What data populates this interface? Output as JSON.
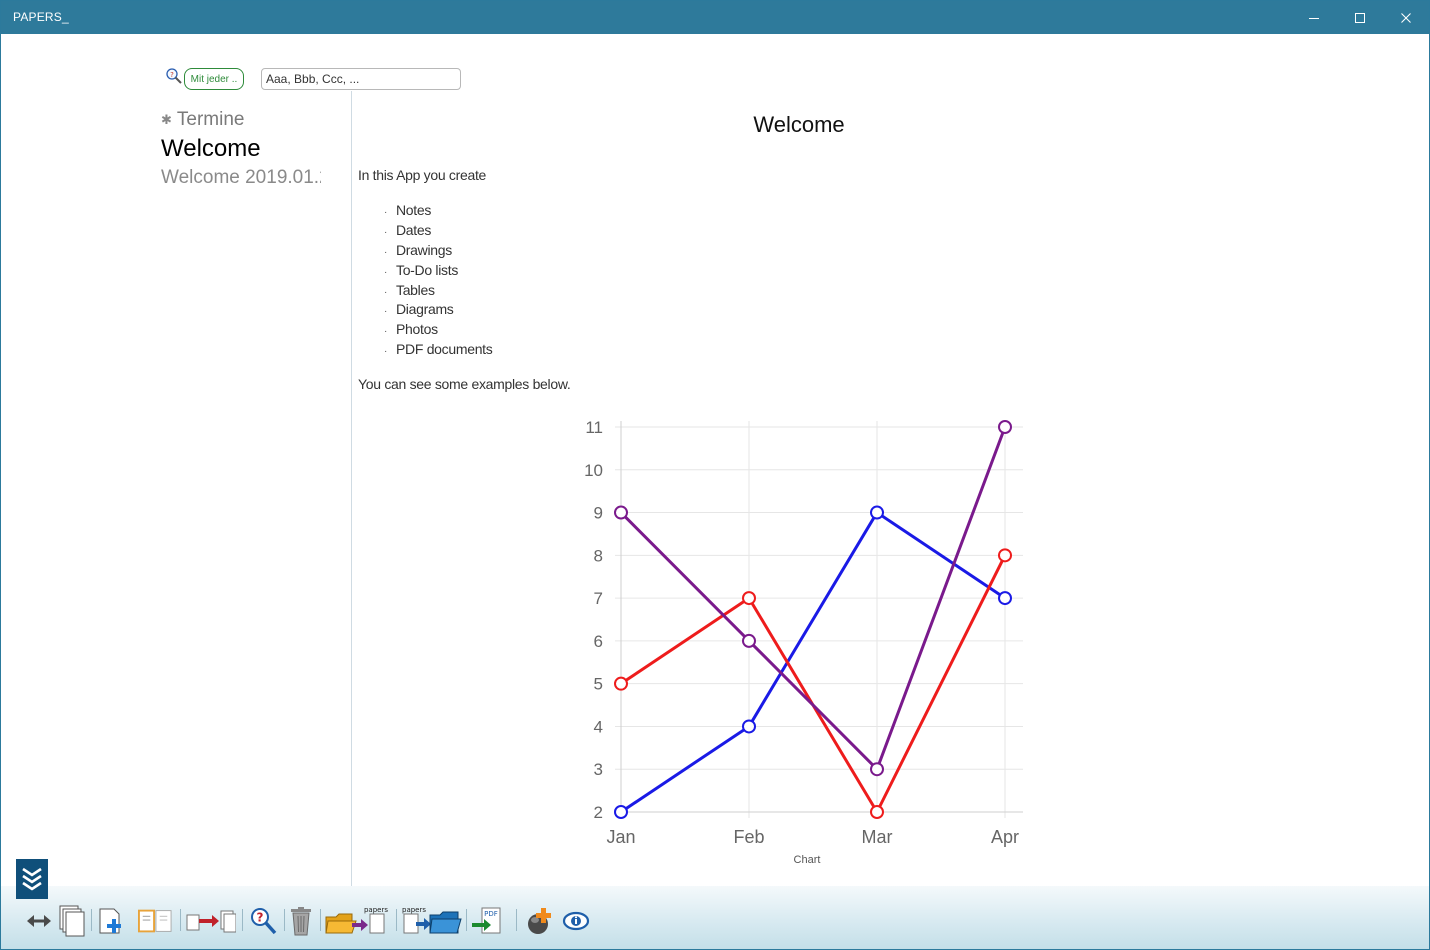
{
  "window": {
    "title": "PAPERS_"
  },
  "search": {
    "mode_label": "Mit jeder ..",
    "placeholder": "Aaa, Bbb, Ccc, ..."
  },
  "sidebar": {
    "items": [
      {
        "label": "Termine",
        "starred": true
      },
      {
        "label": "Welcome"
      },
      {
        "label": "Welcome 2019.01.2"
      }
    ]
  },
  "document": {
    "title": "Welcome",
    "intro": "In this App you create",
    "features": [
      "Notes",
      "Dates",
      "Drawings",
      "To-Do lists",
      "Tables",
      "Diagrams",
      "Photos",
      "PDF documents"
    ],
    "examples_text": "You can see some examples below."
  },
  "chart_data": {
    "type": "line",
    "categories": [
      "Jan",
      "Feb",
      "Mar",
      "Apr"
    ],
    "series": [
      {
        "values": [
          2,
          4,
          9,
          7
        ],
        "color": "#1a1ae6"
      },
      {
        "values": [
          5,
          7,
          2,
          8
        ],
        "color": "#ee1c1c"
      },
      {
        "values": [
          9,
          6,
          3,
          11
        ],
        "color": "#7a1a8c"
      }
    ],
    "yticks": [
      2,
      3,
      4,
      5,
      6,
      7,
      8,
      9,
      10,
      11
    ],
    "ylim": [
      2,
      11
    ],
    "xlabel": "Chart",
    "grid": true
  },
  "toolbar": {
    "buttons": [
      {
        "name": "resize-arrows-icon"
      },
      {
        "name": "copy-pages-icon"
      },
      {
        "name": "new-page-icon"
      },
      {
        "name": "split-view-icon"
      },
      {
        "name": "move-page-icon"
      },
      {
        "name": "help-search-icon"
      },
      {
        "name": "trash-icon"
      },
      {
        "name": "export-papers-icon",
        "tag": "papers"
      },
      {
        "name": "import-papers-icon",
        "tag": "papers"
      },
      {
        "name": "export-pdf-icon",
        "tag": "PDF"
      },
      {
        "name": "add-plugin-icon"
      },
      {
        "name": "info-icon"
      }
    ]
  }
}
